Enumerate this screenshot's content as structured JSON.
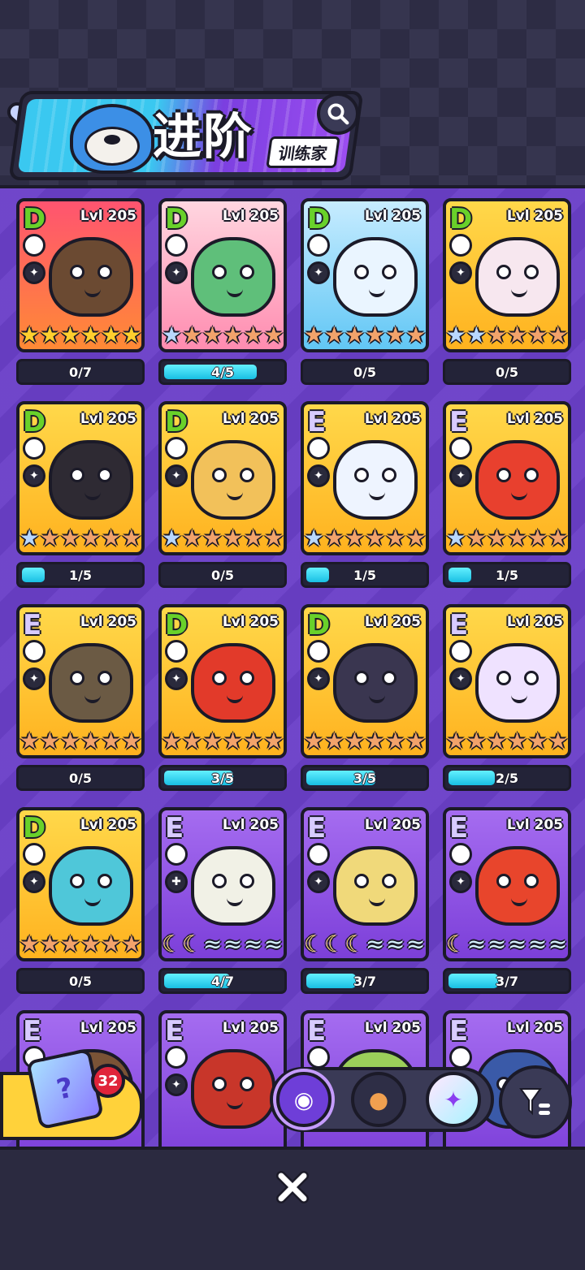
{
  "header": {
    "title": "进阶",
    "subtitle": "训练家",
    "search_icon": "search-icon"
  },
  "cards": [
    {
      "grade": "D",
      "level": "Lvl 205",
      "progress": "0/7",
      "fill": 0.0,
      "bg": "bg-red",
      "creature_color": "#6b4a32",
      "t1": "▲",
      "t2": "✦",
      "stars": [
        "gold",
        "gold",
        "gold",
        "gold",
        "gold",
        "gold"
      ]
    },
    {
      "grade": "D",
      "level": "Lvl 205",
      "progress": "4/5",
      "fill": 0.8,
      "bg": "bg-pink",
      "creature_color": "#5fbf7a",
      "t1": "✿",
      "t2": "✦",
      "stars": [
        "silver",
        "bronze",
        "bronze",
        "bronze",
        "bronze",
        "bronze"
      ]
    },
    {
      "grade": "D",
      "level": "Lvl 205",
      "progress": "0/5",
      "fill": 0.0,
      "bg": "bg-blue",
      "creature_color": "#eaf5ff",
      "t1": "◆",
      "t2": "✦",
      "stars": [
        "bronze",
        "bronze",
        "bronze",
        "bronze",
        "bronze",
        "bronze"
      ]
    },
    {
      "grade": "D",
      "level": "Lvl 205",
      "progress": "0/5",
      "fill": 0.0,
      "bg": "bg-gold",
      "creature_color": "#f7e7ef",
      "t1": "✿",
      "t2": "✦",
      "stars": [
        "silver",
        "silver",
        "bronze",
        "bronze",
        "bronze",
        "bronze"
      ]
    },
    {
      "grade": "D",
      "level": "Lvl 205",
      "progress": "1/5",
      "fill": 0.2,
      "bg": "bg-gold",
      "creature_color": "#2e2a33",
      "t1": "✹",
      "t2": "✦",
      "stars": [
        "silver",
        "bronze",
        "bronze",
        "bronze",
        "bronze",
        "bronze"
      ]
    },
    {
      "grade": "D",
      "level": "Lvl 205",
      "progress": "0/5",
      "fill": 0.0,
      "bg": "bg-gold",
      "creature_color": "#f2c15a",
      "t1": "⚡",
      "t2": "✦",
      "stars": [
        "silver",
        "bronze",
        "bronze",
        "bronze",
        "bronze",
        "bronze"
      ]
    },
    {
      "grade": "E",
      "level": "Lvl 205",
      "progress": "1/5",
      "fill": 0.2,
      "bg": "bg-gold",
      "creature_color": "#eef4ff",
      "t1": "◆",
      "t2": "✦",
      "stars": [
        "silver",
        "bronze",
        "bronze",
        "bronze",
        "bronze",
        "bronze"
      ]
    },
    {
      "grade": "E",
      "level": "Lvl 205",
      "progress": "1/5",
      "fill": 0.2,
      "bg": "bg-gold",
      "creature_color": "#e8402e",
      "t1": "✹",
      "t2": "✦",
      "stars": [
        "silver",
        "bronze",
        "bronze",
        "bronze",
        "bronze",
        "bronze"
      ]
    },
    {
      "grade": "E",
      "level": "Lvl 205",
      "progress": "0/5",
      "fill": 0.0,
      "bg": "bg-gold",
      "creature_color": "#6b5a44",
      "t1": "▲",
      "t2": "✦",
      "stars": [
        "bronze",
        "bronze",
        "bronze",
        "bronze",
        "bronze",
        "bronze"
      ]
    },
    {
      "grade": "D",
      "level": "Lvl 205",
      "progress": "3/5",
      "fill": 0.6,
      "bg": "bg-gold",
      "creature_color": "#e23a2a",
      "t1": "✹",
      "t2": "✦",
      "stars": [
        "bronze",
        "bronze",
        "bronze",
        "bronze",
        "bronze",
        "bronze"
      ]
    },
    {
      "grade": "D",
      "level": "Lvl 205",
      "progress": "3/5",
      "fill": 0.6,
      "bg": "bg-gold",
      "creature_color": "#3a3650",
      "t1": "⚡",
      "t2": "✦",
      "stars": [
        "bronze",
        "bronze",
        "bronze",
        "bronze",
        "bronze",
        "bronze"
      ]
    },
    {
      "grade": "E",
      "level": "Lvl 205",
      "progress": "2/5",
      "fill": 0.4,
      "bg": "bg-gold",
      "creature_color": "#efe2ff",
      "t1": "⚡",
      "t2": "✦",
      "stars": [
        "bronze",
        "bronze",
        "bronze",
        "bronze",
        "bronze",
        "bronze"
      ]
    },
    {
      "grade": "D",
      "level": "Lvl 205",
      "progress": "0/5",
      "fill": 0.0,
      "bg": "bg-gold",
      "creature_color": "#4fc7d9",
      "t1": "◆",
      "t2": "✦",
      "stars": [
        "bronze",
        "bronze",
        "bronze",
        "bronze",
        "bronze",
        "bronze"
      ]
    },
    {
      "grade": "E",
      "level": "Lvl 205",
      "progress": "4/7",
      "fill": 0.57,
      "bg": "bg-purple",
      "creature_color": "#f1f1e6",
      "t1": "✿",
      "t2": "✚",
      "stars": [
        "moon",
        "moon",
        "wave",
        "wave",
        "wave",
        "wave"
      ]
    },
    {
      "grade": "E",
      "level": "Lvl 205",
      "progress": "3/7",
      "fill": 0.43,
      "bg": "bg-purple",
      "creature_color": "#f0d97a",
      "t1": "⚡",
      "t2": "✦",
      "stars": [
        "moon",
        "moon",
        "moon",
        "wave",
        "wave",
        "wave"
      ]
    },
    {
      "grade": "E",
      "level": "Lvl 205",
      "progress": "3/7",
      "fill": 0.43,
      "bg": "bg-purple",
      "creature_color": "#e8452c",
      "t1": "✹",
      "t2": "✦",
      "stars": [
        "moon",
        "wave",
        "wave",
        "wave",
        "wave",
        "wave"
      ]
    },
    {
      "grade": "E",
      "level": "Lvl 205",
      "progress": "",
      "fill": 0.0,
      "bg": "bg-purple",
      "creature_color": "#7a5336",
      "t1": "▲",
      "t2": "✦",
      "stars": []
    },
    {
      "grade": "E",
      "level": "Lvl 205",
      "progress": "",
      "fill": 0.0,
      "bg": "bg-purple",
      "creature_color": "#c8362a",
      "t1": "✹",
      "t2": "✦",
      "stars": []
    },
    {
      "grade": "E",
      "level": "Lvl 205",
      "progress": "",
      "fill": 0.0,
      "bg": "bg-purple",
      "creature_color": "#9bcf5a",
      "t1": "✿",
      "t2": "",
      "stars": []
    },
    {
      "grade": "E",
      "level": "Lvl 205",
      "progress": "",
      "fill": 0.0,
      "bg": "bg-purple",
      "creature_color": "#3a5aa8",
      "t1": "⚡",
      "t2": "",
      "stars": []
    }
  ],
  "gacha": {
    "badge_count": "32",
    "box_glyph": "?"
  },
  "tabs": [
    {
      "icon": "robot-cat-icon",
      "glyph": "◉"
    },
    {
      "icon": "hamster-icon",
      "glyph": "●"
    },
    {
      "icon": "crystal-icon",
      "glyph": "✦"
    }
  ],
  "filter": {
    "icon": "filter-icon"
  },
  "close": {
    "icon": "close-icon"
  }
}
